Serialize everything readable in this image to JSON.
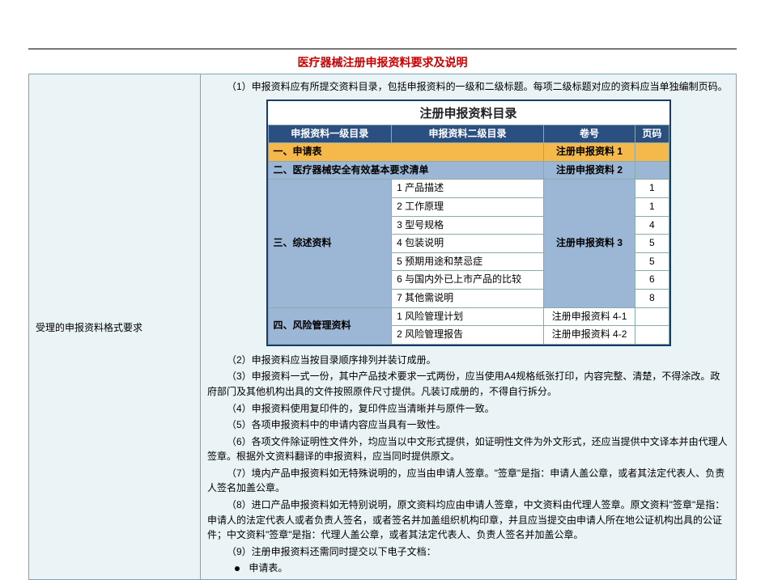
{
  "doc": {
    "title": "医疗器械注册申报资料要求及说明",
    "leftLabel": "受理的申报资料格式要求",
    "p1": "（1）申报资料应有所提交资料目录，包括申报资料的一级和二级标题。每项二级标题对应的资料应当单独编制页码。",
    "p2": "（2）申报资料应当按目录顺序排列并装订成册。",
    "p3": "（3）申报资料一式一份，其中产品技术要求一式两份，应当使用A4规格纸张打印，内容完整、清楚，不得涂改。政府部门及其他机构出具的文件按照原件尺寸提供。凡装订成册的，不得自行拆分。",
    "p4": "（4）申报资料使用复印件的，复印件应当清晰并与原件一致。",
    "p5": "（5）各项申报资料中的申请内容应当具有一致性。",
    "p6": "（6）各项文件除证明性文件外，均应当以中文形式提供，如证明性文件为外文形式，还应当提供中文译本并由代理人签章。根据外文资料翻译的申报资料，应当同时提供原文。",
    "p7": "（7）境内产品申报资料如无特殊说明的，应当由申请人签章。\"签章\"是指：申请人盖公章，或者其法定代表人、负责人签名加盖公章。",
    "p8": "（8）进口产品申报资料如无特别说明，原文资料均应由申请人签章，中文资料由代理人签章。原文资料\"签章\"是指：申请人的法定代表人或者负责人签名，或者签名并加盖组织机构印章，并且应当提交由申请人所在地公证机构出具的公证件；中文资料\"签章\"是指：代理人盖公章，或者其法定代表人、负责人签名并加盖公章。",
    "p9": "（9）注册申报资料还需同时提交以下电子文档：",
    "bullet1": "申请表。",
    "dir": {
      "caption": "注册申报资料目录",
      "h1": "申报资料一级目录",
      "h2": "申报资料二级目录",
      "h3": "卷号",
      "h4": "页码",
      "r1c1": "一、申请表",
      "r1c3": "注册申报资料 1",
      "r2c1": "二、医疗器械安全有效基本要求清单",
      "r2c3": "注册申报资料 2",
      "r3c1": "三、综述资料",
      "r3_rows": [
        {
          "c2": "1 产品描述",
          "c4": "1"
        },
        {
          "c2": "2 工作原理",
          "c4": "1"
        },
        {
          "c2": "3 型号规格",
          "c4": "4"
        },
        {
          "c2": "4 包装说明",
          "c4": "5"
        },
        {
          "c2": "5 预期用途和禁忌症",
          "c4": "5"
        },
        {
          "c2": "6 与国内外已上市产品的比较",
          "c4": "6"
        },
        {
          "c2": "7 其他需说明",
          "c4": "8"
        }
      ],
      "r3c3": "注册申报资料 3",
      "r4c1": "四、风险管理资料",
      "r4_rows": [
        {
          "c2": "1 风险管理计划",
          "c3": "注册申报资料 4-1"
        },
        {
          "c2": "2 风险管理报告",
          "c3": "注册申报资料 4-2"
        }
      ]
    }
  }
}
